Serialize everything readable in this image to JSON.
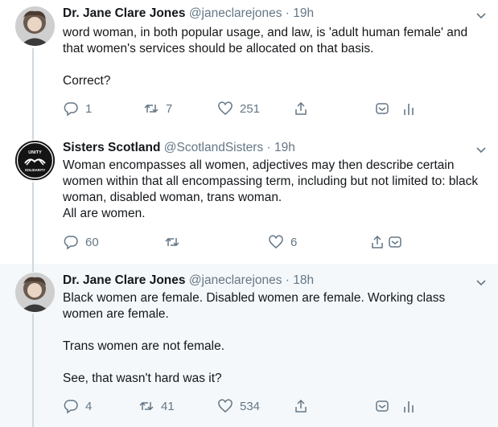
{
  "tweets": [
    {
      "name": "Dr. Jane Clare Jones",
      "handle": "@janeclarejones · 19h",
      "text": "word woman, in both popular usage, and law, is 'adult human female' and that women's services should be allocated on that basis.\n\nCorrect?",
      "replies": "1",
      "retweets": "7",
      "likes": "251"
    },
    {
      "name": "Sisters Scotland",
      "handle": "@ScotlandSisters · 19h",
      "text": "Woman encompasses all women, adjectives may then describe certain women within that all encompassing term, including but not limited to: black woman, disabled woman, trans woman.\nAll are women.",
      "replies": "60",
      "retweets": "",
      "likes": "6",
      "avatar_text_top": "UNITY",
      "avatar_text_bottom": "SOLIDARITY"
    },
    {
      "name": "Dr. Jane Clare Jones",
      "handle": "@janeclarejones · 18h",
      "text": "Black women are female. Disabled women are female. Working class women are female.\n\nTrans women are not female.\n\nSee, that wasn't hard was it?",
      "replies": "4",
      "retweets": "41",
      "likes": "534"
    }
  ],
  "icons": {
    "reply": "reply-icon",
    "retweet": "retweet-icon",
    "like": "heart-icon",
    "share": "share-icon",
    "dm": "dm-icon",
    "analytics": "analytics-icon",
    "caret": "chevron-down-icon"
  },
  "colors": {
    "text": "#14171a",
    "muted": "#657786",
    "highlight_bg": "#f5f8fa",
    "thread_line": "#cfd9de"
  }
}
